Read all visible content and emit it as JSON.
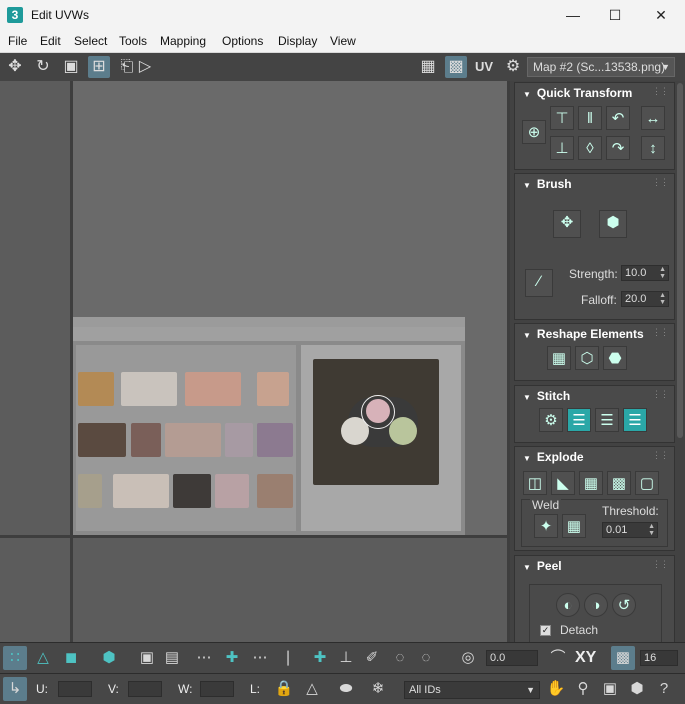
{
  "window": {
    "title": "Edit UVWs",
    "app_icon": "3"
  },
  "menu": [
    "File",
    "Edit",
    "Select",
    "Tools",
    "Mapping",
    "Options",
    "Display",
    "View"
  ],
  "toolbar": {
    "uv_label": "UV",
    "map_select": "Map #2 (Sc...13538.png)"
  },
  "panel": {
    "quick_transform": {
      "title": "Quick Transform"
    },
    "brush": {
      "title": "Brush",
      "strength_label": "Strength:",
      "strength_value": "10.0",
      "falloff_label": "Falloff:",
      "falloff_value": "20.0"
    },
    "reshape": {
      "title": "Reshape Elements"
    },
    "stitch": {
      "title": "Stitch"
    },
    "explode": {
      "title": "Explode",
      "weld_label": "Weld",
      "threshold_label": "Threshold:",
      "threshold_value": "0.01"
    },
    "peel": {
      "title": "Peel",
      "detach_label": "Detach"
    }
  },
  "bottom": {
    "spin_value": "0.0",
    "xy_label": "XY",
    "count_value": "16",
    "u_label": "U:",
    "v_label": "V:",
    "w_label": "W:",
    "l_label": "L:",
    "ids_select": "All IDs"
  },
  "colors": {
    "accent": "#2aa7a7",
    "active": "#5c7d8c",
    "viewport": "#5c5c5c"
  }
}
